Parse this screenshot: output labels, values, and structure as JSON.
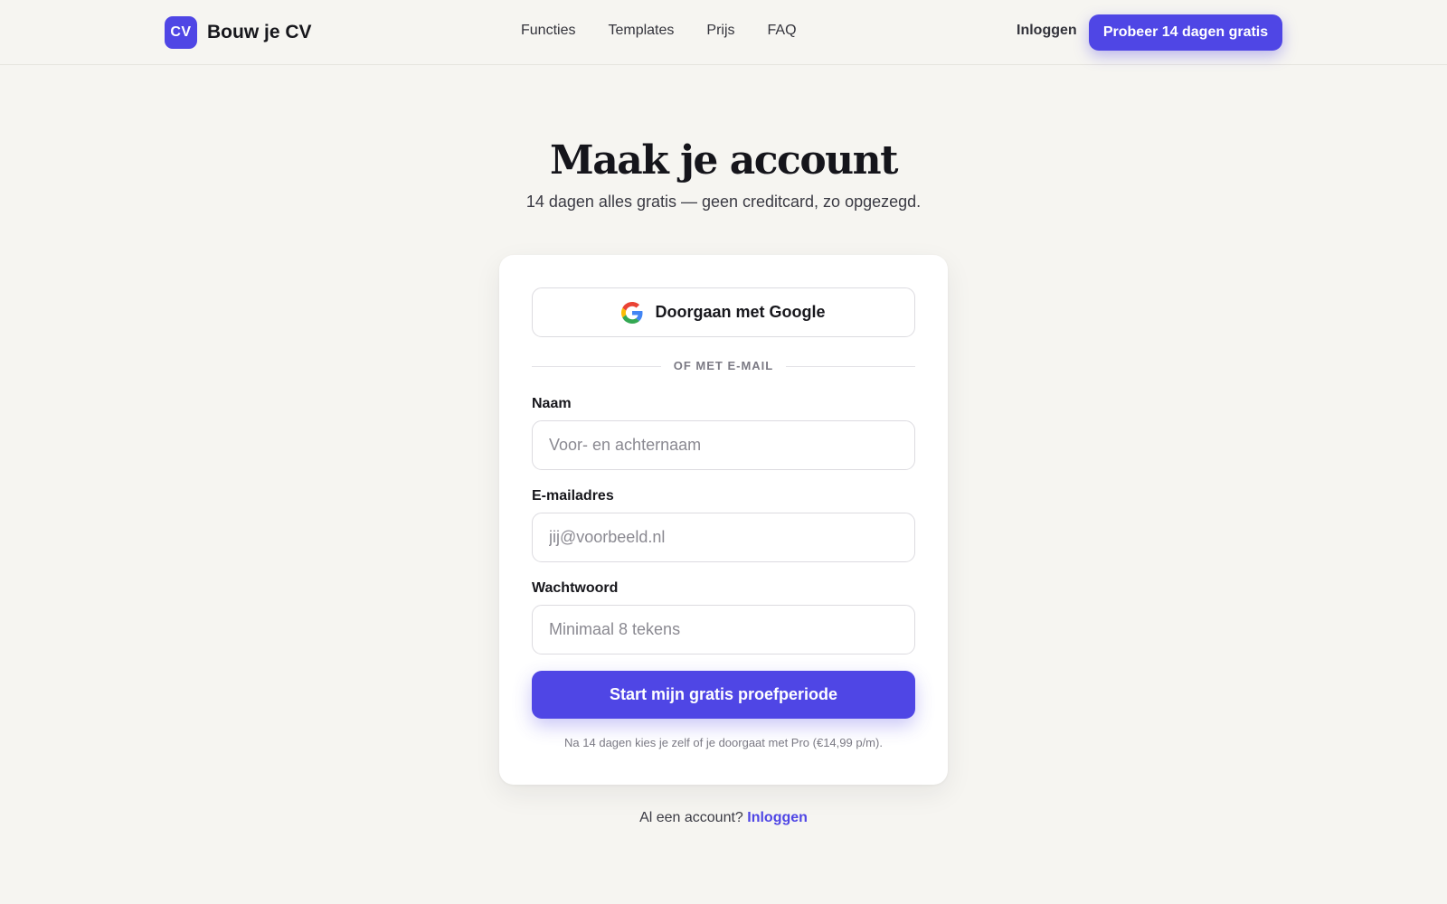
{
  "brand": {
    "logo_text": "CV",
    "name": "Bouw je CV"
  },
  "nav": {
    "items": [
      "Functies",
      "Templates",
      "Prijs",
      "FAQ"
    ]
  },
  "header": {
    "login_label": "Inloggen",
    "trial_label": "Probeer 14 dagen gratis"
  },
  "hero": {
    "title": "Maak je account",
    "subtitle": "14 dagen alles gratis — geen creditcard, zo opgezegd."
  },
  "form": {
    "google_label": "Doorgaan met Google",
    "divider_text": "OF MET E-MAIL",
    "name_label": "Naam",
    "name_placeholder": "Voor- en achternaam",
    "name_value": "",
    "email_label": "E-mailadres",
    "email_placeholder": "jij@voorbeeld.nl",
    "email_value": "",
    "password_label": "Wachtwoord",
    "password_placeholder": "Minimaal 8 tekens",
    "password_value": "",
    "submit_label": "Start mijn gratis proefperiode",
    "fineprint": "Na 14 dagen kies je zelf of je doorgaat met Pro (€14,99 p/m)."
  },
  "footer": {
    "prompt": "Al een account?",
    "login_link": "Inloggen"
  },
  "colors": {
    "accent": "#4f46e5",
    "background": "#f6f5f1"
  },
  "icons": {
    "google": "google-g-icon"
  }
}
